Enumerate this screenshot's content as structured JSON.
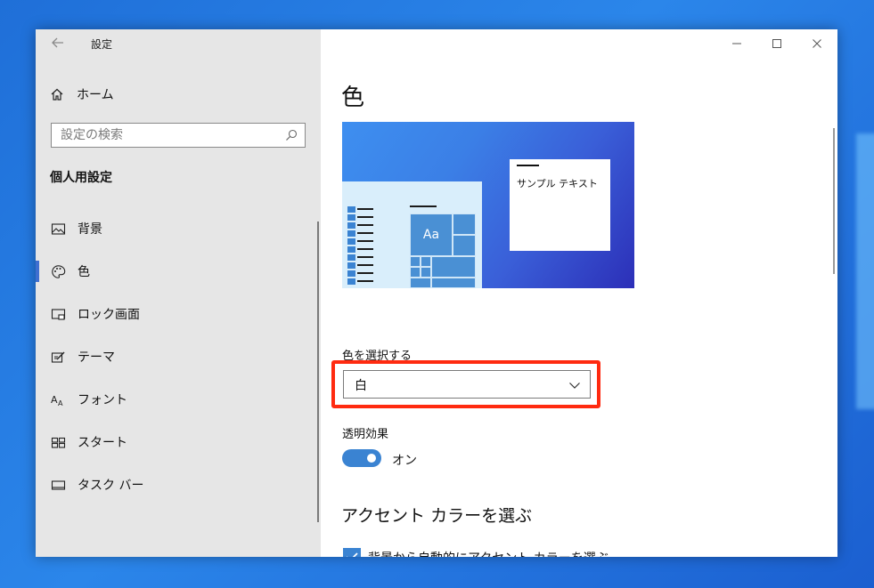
{
  "window": {
    "title": "設定"
  },
  "sidebar": {
    "home_label": "ホーム",
    "search_placeholder": "設定の検索",
    "section_heading": "個人用設定",
    "items": [
      {
        "label": "背景",
        "icon": "picture-icon",
        "selected": false
      },
      {
        "label": "色",
        "icon": "palette-icon",
        "selected": true
      },
      {
        "label": "ロック画面",
        "icon": "lock-screen-icon",
        "selected": false
      },
      {
        "label": "テーマ",
        "icon": "theme-icon",
        "selected": false
      },
      {
        "label": "フォント",
        "icon": "font-icon",
        "selected": false
      },
      {
        "label": "スタート",
        "icon": "start-icon",
        "selected": false
      },
      {
        "label": "タスク バー",
        "icon": "taskbar-icon",
        "selected": false
      }
    ]
  },
  "main": {
    "title": "色",
    "preview": {
      "sample_text": "サンプル テキスト",
      "tile_text": "Aa"
    },
    "select_color_label": "色を選択する",
    "select_color_value": "白",
    "transparency_label": "透明効果",
    "transparency_state": "オン",
    "accent_heading": "アクセント カラーを選ぶ",
    "auto_accent_label": "背景から自動的にアクセント カラーを選ぶ"
  },
  "colors": {
    "accent": "#3a83d2",
    "highlight": "#ff2a10",
    "sidebar_bg": "#e6e6e6"
  }
}
